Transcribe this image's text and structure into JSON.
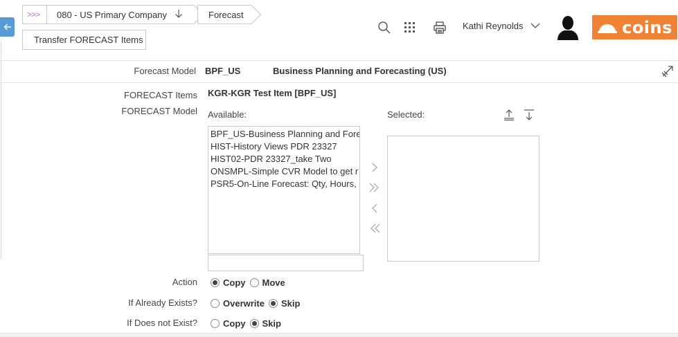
{
  "breadcrumbs": {
    "home": ">>>",
    "company": "080 - US Primary Company",
    "forecast": "Forecast",
    "current": "Transfer FORECAST Items"
  },
  "header": {
    "user_name": "Kathi Reynolds",
    "logo_text": "coins",
    "brand_color": "#f08236",
    "accent_color": "#5b9bd5"
  },
  "forecast_model": {
    "label": "Forecast Model",
    "code": "BPF_US",
    "description": "Business Planning and Forecasting (US)"
  },
  "form": {
    "items_label": "FORECAST Items",
    "items_value": "KGR-KGR Test Item [BPF_US]",
    "model_label": "FORECAST Model",
    "available_label": "Available:",
    "selected_label": "Selected:",
    "available_options": [
      "BPF_US-Business Planning and Fore",
      "HIST-History Views PDR 23327",
      "HIST02-PDR 23327_take Two",
      "ONSMPL-Simple CVR Model to get r",
      "PSR5-On-Line Forecast: Qty, Hours,"
    ],
    "selected_options": [],
    "filter_value": ""
  },
  "action": {
    "label": "Action",
    "options": [
      "Copy",
      "Move"
    ],
    "selected": "Copy"
  },
  "if_exists": {
    "label": "If Already Exists?",
    "options": [
      "Overwrite",
      "Skip"
    ],
    "selected": "Skip"
  },
  "if_not_exists": {
    "label": "If Does not Exist?",
    "options": [
      "Copy",
      "Skip"
    ],
    "selected": "Skip"
  }
}
